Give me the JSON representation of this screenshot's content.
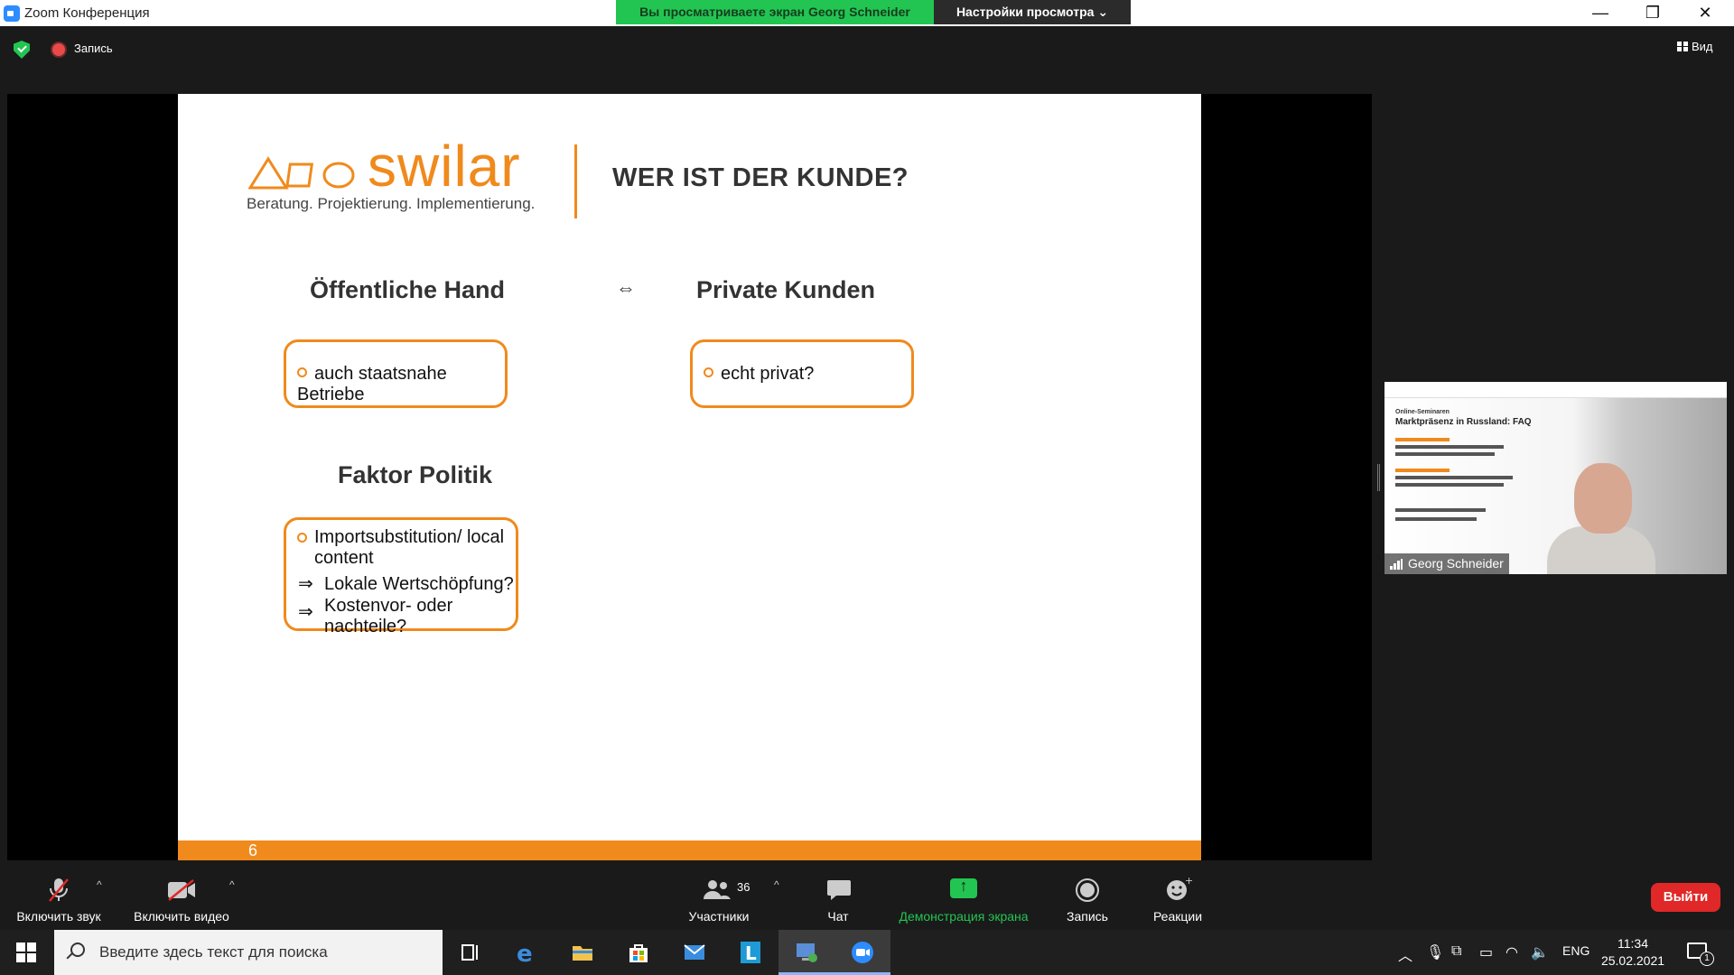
{
  "window": {
    "title": "Zoom Конференция",
    "share_banner": "Вы просматриваете экран Georg Schneider",
    "view_options": "Настройки просмотра",
    "minimize": "—",
    "restore": "❐",
    "close": "✕"
  },
  "topbar": {
    "recording_label": "Запись",
    "view_label": "Вид"
  },
  "slide": {
    "logo_text": "swilar",
    "logo_tagline": "Beratung. Projektierung. Implementierung.",
    "title": "WER IST DER KUNDE?",
    "left_heading": "Öffentliche Hand",
    "exchange_symbol": "⇔",
    "right_heading": "Private Kunden",
    "left_box_item": "auch staatsnahe Betriebe",
    "right_box_item": "echt privat?",
    "politics_heading": "Faktor Politik",
    "politics_items": [
      "Importsubstitution/ local content",
      "Lokale Wertschöpfung?",
      "Kostenvor- oder nachteile?"
    ],
    "arrow_symbol": "⇒",
    "page_number": "6"
  },
  "video": {
    "participant_name": "Georg Schneider",
    "poster_title": "Marktpräsenz in Russland: FAQ",
    "poster_subtitle": "Online-Seminaren"
  },
  "toolbar": {
    "audio_label": "Включить звук",
    "video_label": "Включить видео",
    "participants_label": "Участники",
    "participants_count": "36",
    "chat_label": "Чат",
    "share_label": "Демонстрация экрана",
    "record_label": "Запись",
    "reactions_label": "Реакции",
    "leave_label": "Выйти",
    "caret": "^"
  },
  "taskbar": {
    "search_placeholder": "Введите здесь текст для поиска",
    "language": "ENG",
    "time": "11:34",
    "date": "25.02.2021",
    "notification_count": "1"
  },
  "colors": {
    "accent_orange": "#f08a1c",
    "zoom_green": "#23c552",
    "leave_red": "#e02828",
    "zoom_blue": "#2d8cff"
  }
}
